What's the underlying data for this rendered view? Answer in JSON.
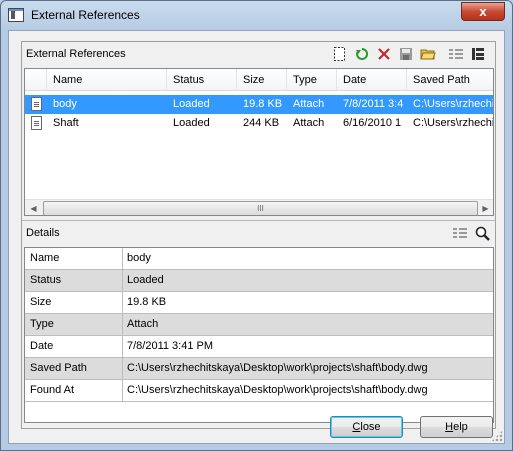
{
  "window": {
    "title": "External References",
    "close_glyph": "x"
  },
  "xrefs": {
    "section_label": "External References",
    "toolbar": {
      "new_icon": "new-document-icon",
      "refresh_icon": "refresh-icon",
      "delete_icon": "delete-icon",
      "save_icon": "save-icon",
      "open_icon": "open-folder-icon",
      "list_view_icon": "list-view-icon",
      "tree_view_icon": "tree-view-icon"
    },
    "columns": [
      "Name",
      "Status",
      "Size",
      "Type",
      "Date",
      "Saved Path"
    ],
    "rows": [
      {
        "name": "body",
        "status": "Loaded",
        "size": "19.8 KB",
        "type": "Attach",
        "date": "7/8/2011 3:4",
        "saved_path": "C:\\Users\\rzhechi",
        "selected": true
      },
      {
        "name": "Shaft",
        "status": "Loaded",
        "size": "244 KB",
        "type": "Attach",
        "date": "6/16/2010 1",
        "saved_path": "C:\\Users\\rzhechi",
        "selected": false
      }
    ],
    "scroll_thumb_glyph": "III"
  },
  "details": {
    "section_label": "Details",
    "rows": [
      {
        "key": "Name",
        "value": "body"
      },
      {
        "key": "Status",
        "value": "Loaded"
      },
      {
        "key": "Size",
        "value": "19.8 KB"
      },
      {
        "key": "Type",
        "value": "Attach"
      },
      {
        "key": "Date",
        "value": "7/8/2011 3:41 PM"
      },
      {
        "key": "Saved Path",
        "value": "C:\\Users\\rzhechitskaya\\Desktop\\work\\projects\\shaft\\body.dwg"
      },
      {
        "key": "Found At",
        "value": "C:\\Users\\rzhechitskaya\\Desktop\\work\\projects\\shaft\\body.dwg"
      }
    ]
  },
  "buttons": {
    "close_first": "C",
    "close_rest": "lose",
    "help_first": "H",
    "help_rest": "elp"
  },
  "colors": {
    "selection": "#3399ff",
    "close_button": "#c74a32"
  }
}
